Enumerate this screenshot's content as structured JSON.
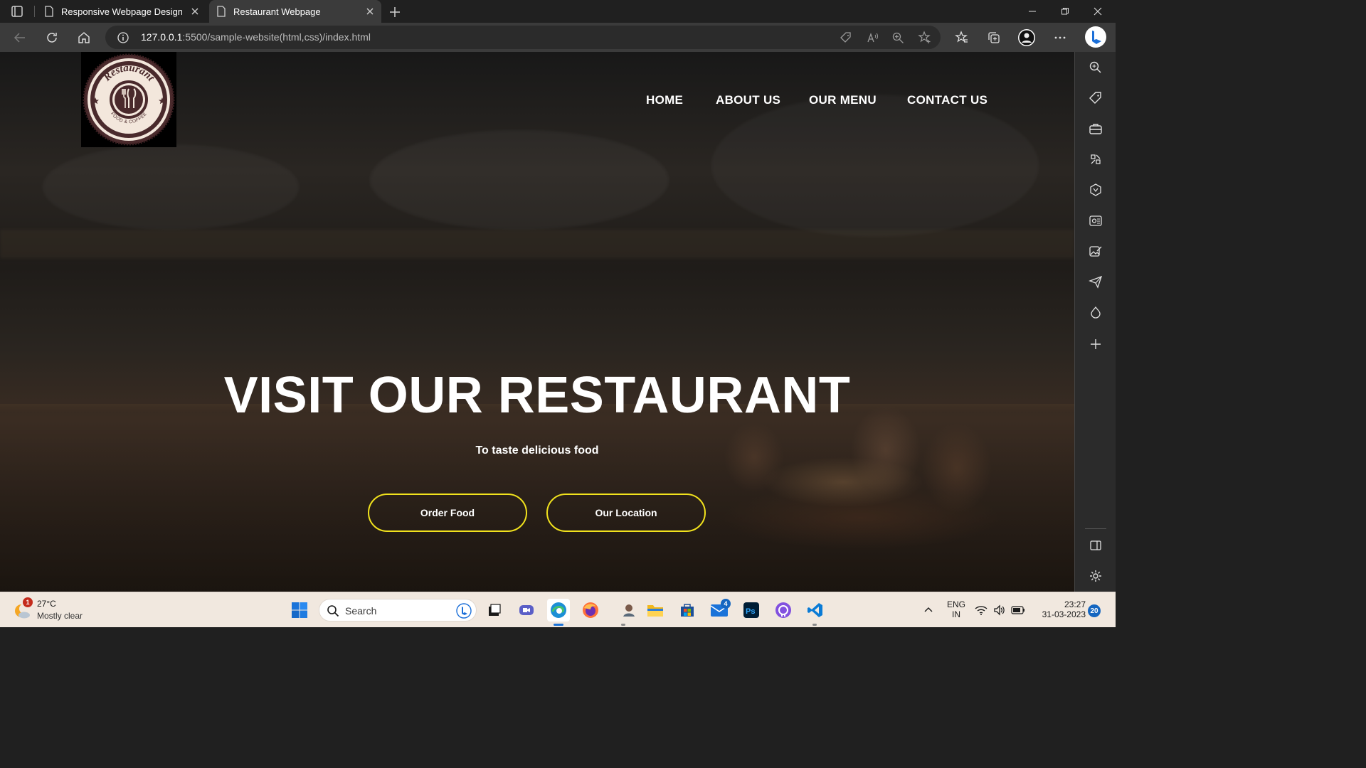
{
  "browser": {
    "tabs": [
      {
        "title": "Responsive Webpage Design",
        "active": false
      },
      {
        "title": "Restaurant Webpage",
        "active": true
      }
    ],
    "address": {
      "host": "127.0.0.1",
      "rest": ":5500/sample-website(html,css)/index.html"
    }
  },
  "page": {
    "logo": {
      "arc_text": "Restaurant",
      "bottom_text": "FOOD & COFFEE"
    },
    "nav": [
      "HOME",
      "ABOUT US",
      "OUR MENU",
      "CONTACT US"
    ],
    "hero": {
      "title": "VISIT OUR RESTAURANT",
      "subtitle": "To taste delicious food",
      "buttons": [
        "Order Food",
        "Our Location"
      ]
    },
    "colors": {
      "button_border": "#f1e21d",
      "text": "#ffffff"
    }
  },
  "taskbar": {
    "weather": {
      "temp": "27°C",
      "condition": "Mostly clear",
      "badge": "1"
    },
    "search_label": "Search",
    "mail_badge": "4",
    "language": {
      "line1": "ENG",
      "line2": "IN"
    },
    "clock": {
      "time": "23:27",
      "date": "31-03-2023"
    },
    "notification_count": "20"
  }
}
